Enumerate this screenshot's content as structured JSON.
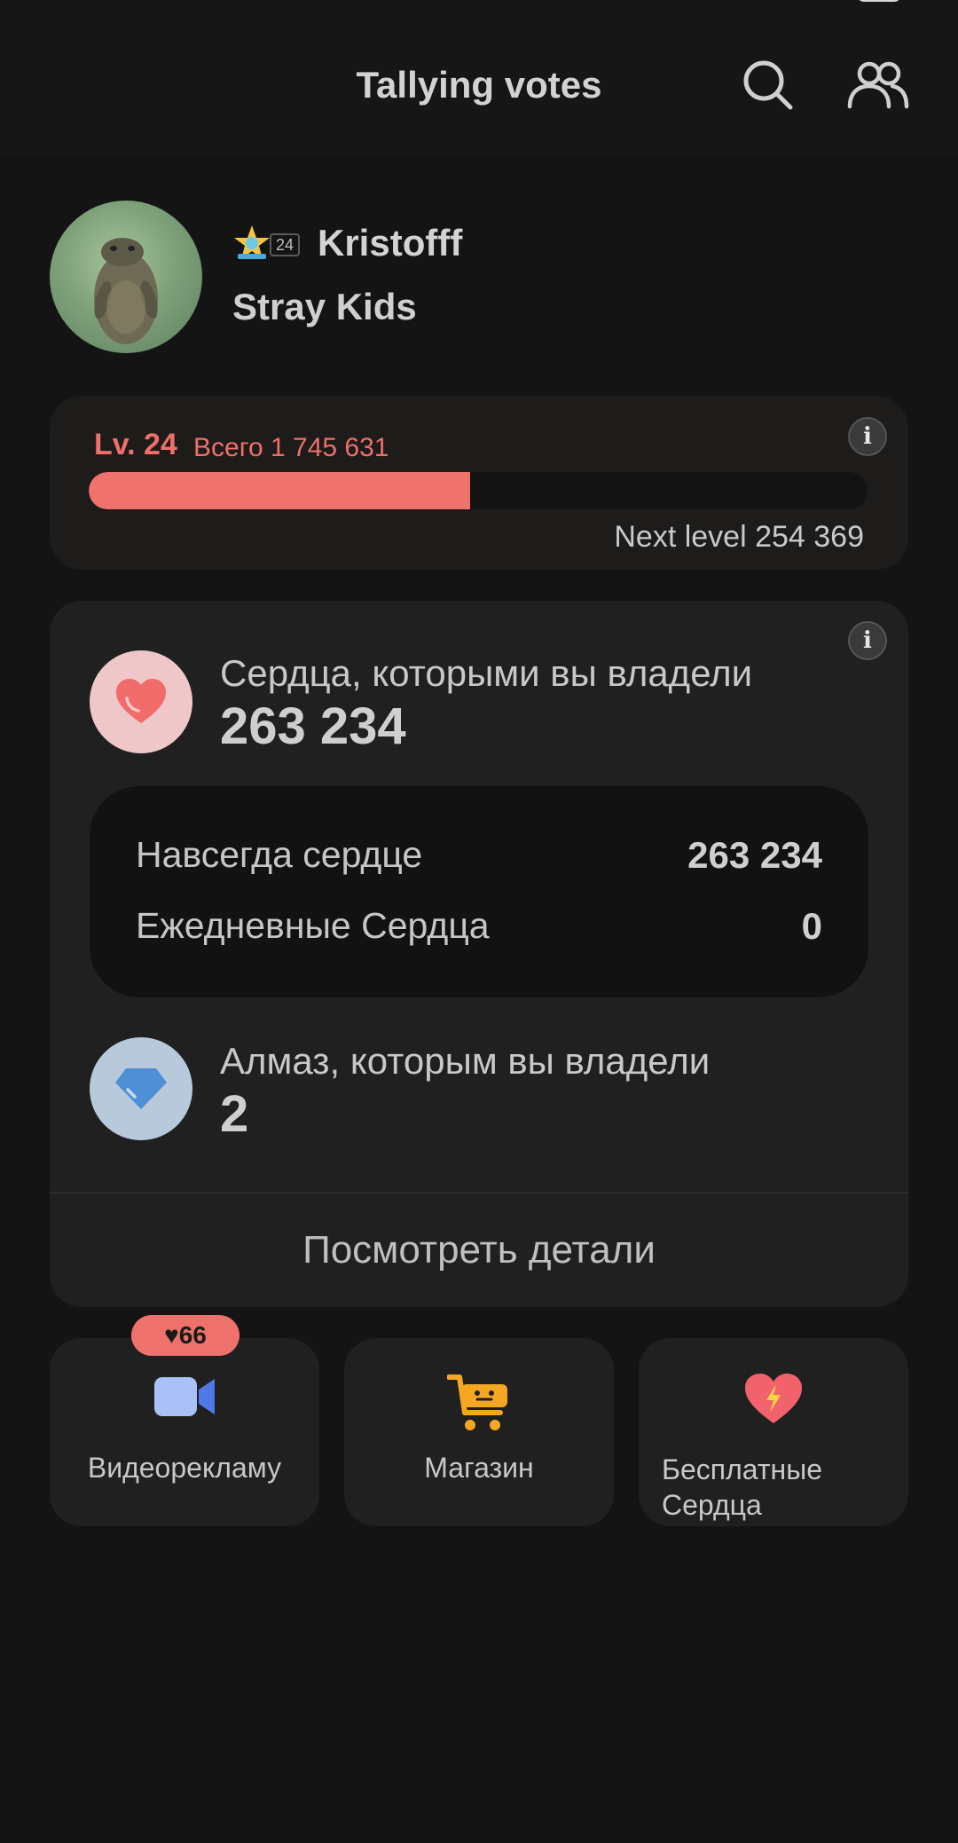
{
  "header": {
    "title": "Tallying votes"
  },
  "profile": {
    "badge_level": "24",
    "username": "Kristofff",
    "fandom": "Stray Kids"
  },
  "level": {
    "label": "Lv. 24",
    "total": "Всего 1 745 631",
    "progress_fraction": 0.49,
    "next_level": "Next level 254 369"
  },
  "hearts": {
    "owned_label": "Сердца, которыми вы владели",
    "owned_value": "263 234",
    "rows": [
      {
        "label": "Навсегда сердце",
        "value": "263 234"
      },
      {
        "label": "Ежедневные Сердца",
        "value": "0"
      }
    ],
    "diamond_label": "Алмаз, которым вы владели",
    "diamond_value": "2",
    "details_link": "Посмотреть детали"
  },
  "tiles": {
    "ad": {
      "badge": "♥66",
      "label": "Видеорекламу"
    },
    "shop": {
      "label": "Магазин"
    },
    "free": {
      "label": "Бесплатные Сердца"
    }
  },
  "colors": {
    "accent": "#ef716c",
    "background": "#141414",
    "card": "#202020"
  }
}
